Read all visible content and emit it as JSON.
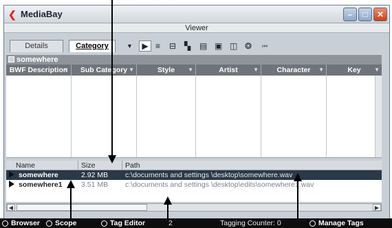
{
  "window": {
    "title": "MediaBay"
  },
  "viewer": {
    "label": "Viewer"
  },
  "tabs": [
    {
      "label": "Details"
    },
    {
      "label": "Category"
    }
  ],
  "toolbar": {
    "tools": [
      "▶",
      "≡",
      "⊟",
      "▚",
      "▤",
      "▣",
      "◫",
      "❂",
      "⏮"
    ]
  },
  "section": {
    "title": "somewhere"
  },
  "category_columns": [
    "BWF Description",
    "Sub Category",
    "Style",
    "Artist",
    "Character",
    "Key"
  ],
  "list": {
    "columns": [
      "Name",
      "Size",
      "Path"
    ],
    "rows": [
      {
        "name": "somewhere",
        "size": "2.92 MB",
        "path": "c:\\documents and settings \\desktop\\somewhere.wav",
        "selected": true
      },
      {
        "name": "somewhere1",
        "size": "3.51 MB",
        "path": "c:\\documents and settings \\desktop\\edits\\somewhere1.wav",
        "selected": false
      }
    ]
  },
  "statusbar": {
    "browser": "Browser",
    "scope": "Scope",
    "tag_editor": "Tag Editor",
    "count": "2",
    "tagging_counter": "Tagging Counter: 0",
    "manage_tags": "Manage Tags"
  }
}
